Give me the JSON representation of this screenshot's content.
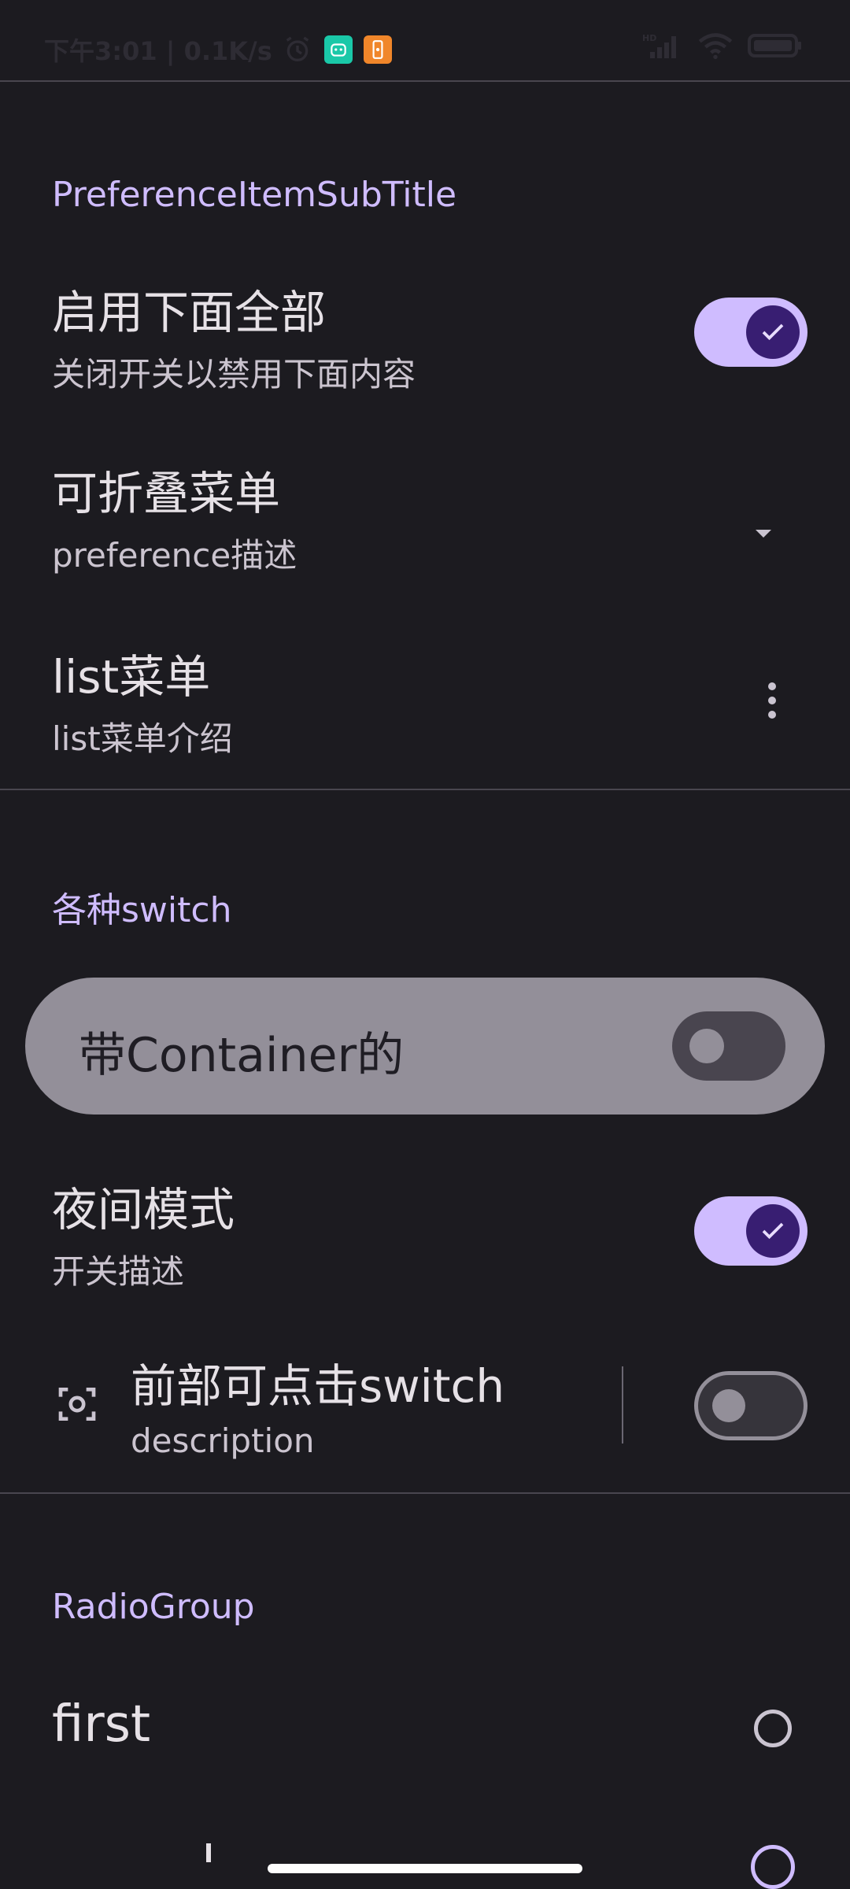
{
  "status_bar": {
    "time_and_speed": "下午3:01 | 0.1K/s",
    "app_icon_1": "android-icon",
    "app_icon_2": "phone-icon",
    "signal": "HD",
    "icons": [
      "alarm-icon",
      "signal-icon",
      "wifi-icon",
      "battery-icon"
    ]
  },
  "section_1": {
    "title": "PreferenceItemSubTitle",
    "items": [
      {
        "title": "启用下面全部",
        "description": "关闭开关以禁用下面内容",
        "control": "switch-on"
      },
      {
        "title": "可折叠菜单",
        "description": "preference描述",
        "control": "dropdown"
      },
      {
        "title": "list菜单",
        "description": "list菜单介绍",
        "control": "more"
      }
    ]
  },
  "section_2": {
    "title": "各种switch",
    "container_item": {
      "title": "带Container的",
      "checked": false
    },
    "night_mode": {
      "title": "夜间模式",
      "description": "开关描述",
      "checked": true
    },
    "front_clickable": {
      "title": "前部可点击switch",
      "description": "description",
      "icon": "center-focus-icon",
      "checked": false
    }
  },
  "section_3": {
    "title": "RadioGroup",
    "options": [
      {
        "label": "first",
        "selected": false
      }
    ]
  },
  "colors": {
    "background": "#1c1b20",
    "accent": "#cfbcff",
    "thumb_on": "#381e72",
    "container_card": "#938f99"
  }
}
